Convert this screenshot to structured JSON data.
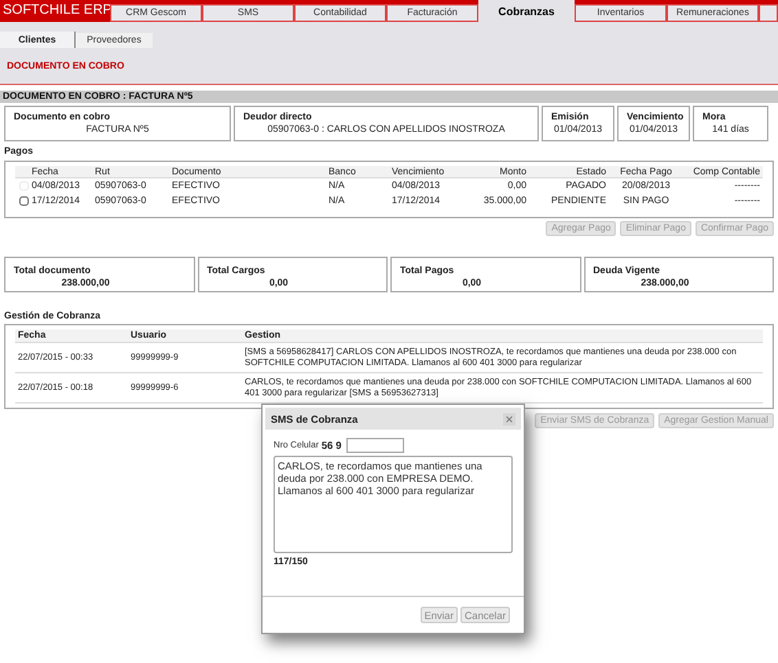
{
  "app": {
    "logo": "SOFTCHILE ERP"
  },
  "tabs": [
    {
      "label": "CRM Gescom",
      "selected": false
    },
    {
      "label": "SMS",
      "selected": false
    },
    {
      "label": "Contabilidad",
      "selected": false
    },
    {
      "label": "Facturación",
      "selected": false
    },
    {
      "label": "Cobranzas",
      "selected": true
    },
    {
      "label": "Inventarios",
      "selected": false
    },
    {
      "label": "Remuneraciones",
      "selected": false
    }
  ],
  "subtabs": [
    {
      "label": "Clientes",
      "selected": true
    },
    {
      "label": "Proveedores",
      "selected": false
    }
  ],
  "page_title": "DOCUMENTO EN COBRO",
  "section_title": "DOCUMENTO EN COBRO : FACTURA Nº5",
  "info_cards": [
    {
      "label": "Documento en cobro",
      "value": "FACTURA Nº5"
    },
    {
      "label": "Deudor directo",
      "value": "05907063-0 : CARLOS CON APELLIDOS INOSTROZA"
    },
    {
      "label": "Emisión",
      "value": "01/04/2013"
    },
    {
      "label": "Vencimiento",
      "value": "01/04/2013"
    },
    {
      "label": "Mora",
      "value": "141 días"
    }
  ],
  "pagos": {
    "title": "Pagos",
    "columns": [
      "Fecha",
      "Rut",
      "Documento",
      "Banco",
      "Vencimiento",
      "Monto",
      "Estado",
      "Fecha Pago",
      "Comp Contable"
    ],
    "rows": [
      {
        "checked": false,
        "disabled": true,
        "cells": [
          "04/08/2013",
          "05907063-0",
          "EFECTIVO",
          "N/A",
          "04/08/2013",
          "0,00",
          "PAGADO",
          "20/08/2013",
          "--------"
        ]
      },
      {
        "checked": false,
        "disabled": false,
        "cells": [
          "17/12/2014",
          "05907063-0",
          "EFECTIVO",
          "N/A",
          "17/12/2014",
          "35.000,00",
          "PENDIENTE",
          "SIN PAGO",
          "--------"
        ]
      }
    ],
    "buttons": [
      "Agregar Pago",
      "Eliminar Pago",
      "Confirmar Pago"
    ]
  },
  "totals": [
    {
      "label": "Total documento",
      "value": "238.000,00"
    },
    {
      "label": "Total Cargos",
      "value": "0,00"
    },
    {
      "label": "Total Pagos",
      "value": "0,00"
    },
    {
      "label": "Deuda Vigente",
      "value": "238.000,00"
    }
  ],
  "gestion": {
    "title": "Gestión de Cobranza",
    "columns": [
      "Fecha",
      "Usuario",
      "Gestion"
    ],
    "rows": [
      [
        "22/07/2015 - 00:33",
        "99999999-9",
        "[SMS a 56958628417] CARLOS CON APELLIDOS INOSTROZA, te recordamos que mantienes una deuda por 238.000 con SOFTCHILE COMPUTACION LIMITADA. Llamanos al 600 401 3000 para regularizar"
      ],
      [
        "22/07/2015 - 00:18",
        "99999999-6",
        "CARLOS, te recordamos que mantienes una deuda por 238.000 con SOFTCHILE COMPUTACION LIMITADA. Llamanos al 600 401 3000 para regularizar [SMS a 56953627313]"
      ]
    ],
    "buttons": [
      "Enviar SMS de Cobranza",
      "Agregar Gestion Manual"
    ]
  },
  "dialog": {
    "title": "SMS de Cobranza",
    "phone_label": "Nro Celular",
    "phone_prefix": "56 9",
    "message": "CARLOS, te recordamos que mantienes una deuda por 238.000 con EMPRESA DEMO. Llamanos al 600 401 3000 para regularizar",
    "counter": "117/150",
    "buttons": [
      "Enviar",
      "Cancelar"
    ]
  }
}
